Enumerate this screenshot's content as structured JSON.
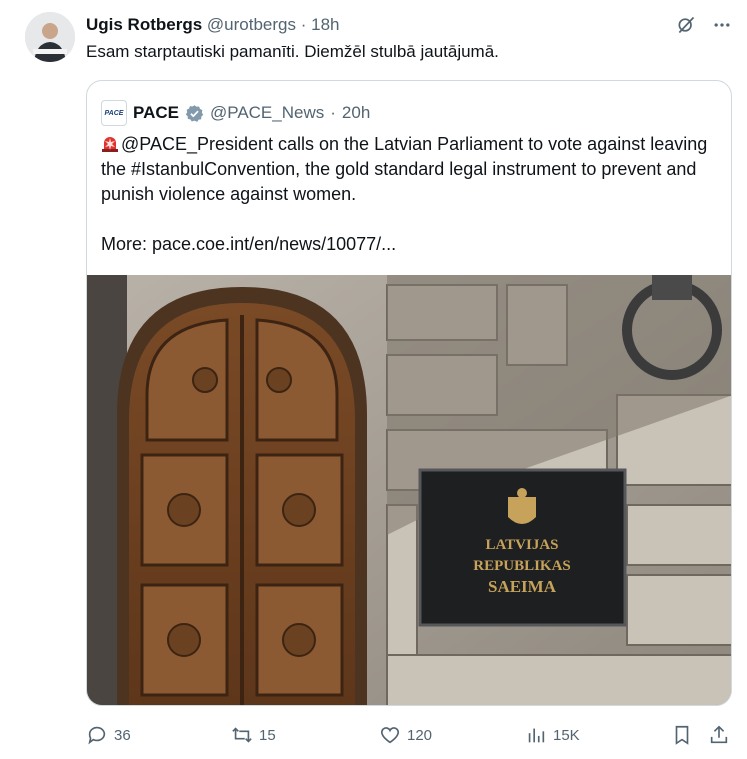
{
  "tweet": {
    "author_name": "Ugis Rotbergs",
    "handle": "@urotbergs",
    "separator": "·",
    "time": "18h",
    "text": "Esam starptautiski pamanīti. Diemžēl stulbā jautājumā."
  },
  "quote": {
    "avatar_label": "PACE",
    "author_name": "PACE",
    "verified_icon": "verified-badge-icon",
    "handle": "@PACE_News",
    "separator": "·",
    "time": "20h",
    "line1": "@PACE_President calls on the Latvian Parliament to vote against leaving the #IstanbulConvention, the gold standard legal instrument to prevent and punish violence against women.",
    "more": "More: pace.coe.int/en/news/10077/...",
    "plaque_line1": "LATVIJAS",
    "plaque_line2": "REPUBLIKAS",
    "plaque_line3": "SAEIMA"
  },
  "actions": {
    "replies": "36",
    "reposts": "15",
    "likes": "120",
    "views": "15K"
  },
  "colors": {
    "text": "#0f1419",
    "muted": "#536471",
    "border": "#cfd9de",
    "verified": "#829aab"
  }
}
